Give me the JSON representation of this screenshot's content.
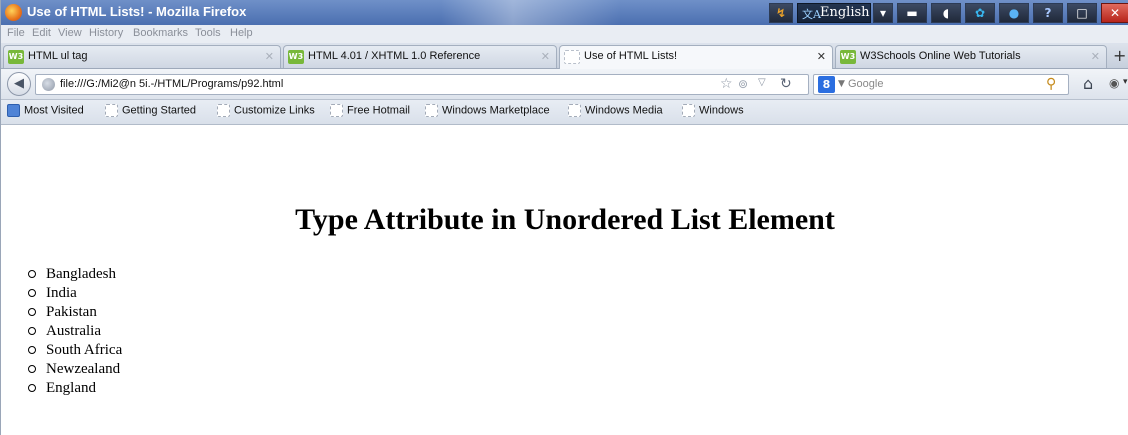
{
  "window": {
    "title": "Use of HTML Lists! - Mozilla Firefox",
    "language": "English"
  },
  "menu": [
    "File",
    "Edit",
    "View",
    "History",
    "Bookmarks",
    "Tools",
    "Help"
  ],
  "tabs": [
    {
      "label": "HTML ul tag",
      "active": false
    },
    {
      "label": "HTML 4.01 / XHTML 1.0 Reference",
      "active": false
    },
    {
      "label": "Use of HTML Lists!",
      "active": true
    },
    {
      "label": "W3Schools Online Web Tutorials",
      "active": false
    }
  ],
  "nav": {
    "url": "file:///G:/Mi2@n 5i.-/HTML/Programs/p92.html",
    "search_engine": "Google"
  },
  "bookmarks": [
    "Most Visited",
    "Getting Started",
    "Customize Links",
    "Free Hotmail",
    "Windows Marketplace",
    "Windows Media",
    "Windows"
  ],
  "page": {
    "heading": "Type Attribute in Unordered List Element",
    "list_items": [
      "Bangladesh",
      "India",
      "Pakistan",
      "Australia",
      "South Africa",
      "Newzealand",
      "England"
    ]
  },
  "icons": {
    "firefox": "firefox-icon",
    "back": "back-arrow-icon",
    "reload": "reload-icon",
    "bookmark_star": "star-icon",
    "search": "magnifier-icon",
    "home": "home-icon",
    "close_window": "close-icon"
  },
  "colors": {
    "titlebar": "#5b7cba",
    "close_button": "#c9302c",
    "tab_favicon": "#78b83a"
  }
}
